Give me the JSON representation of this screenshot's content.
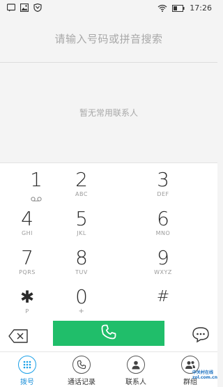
{
  "status_bar": {
    "time": "17:26",
    "left_icons": [
      "message-icon",
      "image-icon",
      "shield-icon"
    ],
    "right_icons": [
      "wifi-icon",
      "battery-icon"
    ]
  },
  "search": {
    "placeholder": "请输入号码或拼音搜索"
  },
  "contacts": {
    "empty_text": "暂无常用联系人"
  },
  "keypad": {
    "keys": [
      {
        "digit": "1",
        "letters": ""
      },
      {
        "digit": "2",
        "letters": "ABC"
      },
      {
        "digit": "3",
        "letters": "DEF"
      },
      {
        "digit": "4",
        "letters": "GHI"
      },
      {
        "digit": "5",
        "letters": "JKL"
      },
      {
        "digit": "6",
        "letters": "MNO"
      },
      {
        "digit": "7",
        "letters": "PQRS"
      },
      {
        "digit": "8",
        "letters": "TUV"
      },
      {
        "digit": "9",
        "letters": "WXYZ"
      },
      {
        "digit": "✱",
        "letters": "P"
      },
      {
        "digit": "0",
        "letters": "+"
      },
      {
        "digit": "#",
        "letters": ""
      }
    ]
  },
  "actions": {
    "delete_icon": "backspace-icon",
    "call_icon": "phone-icon",
    "message_icon": "chat-bubble-icon",
    "call_color": "#20be6a"
  },
  "tabs": [
    {
      "label": "拨号",
      "icon": "keypad-icon",
      "active": true
    },
    {
      "label": "通话记录",
      "icon": "phone-icon",
      "active": false
    },
    {
      "label": "联系人",
      "icon": "person-icon",
      "active": false
    },
    {
      "label": "群组",
      "icon": "group-icon",
      "active": false
    }
  ],
  "watermark": {
    "line1": "中关村在线",
    "line2": "zol.com.cn"
  },
  "colors": {
    "accent": "#1a8fd9",
    "call_green": "#20be6a"
  }
}
